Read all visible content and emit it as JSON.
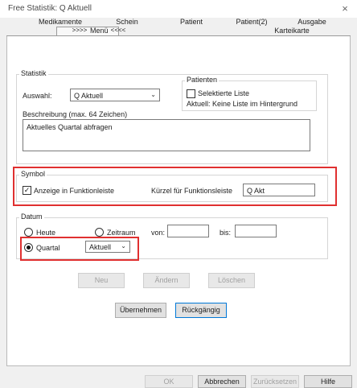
{
  "window": {
    "title": "Free Statistik: Q Aktuell",
    "close_glyph": "×"
  },
  "tabs_top": [
    "Medikamente",
    "Schein",
    "Patient",
    "Patient(2)",
    "Ausgabe"
  ],
  "tabs_bottom": {
    "left": ">>>>",
    "active": "Menü",
    "right": "<<<<",
    "far": "Karteikarte"
  },
  "statistik": {
    "legend": "Statistik",
    "auswahl_label": "Auswahl:",
    "auswahl_value": "Q Aktuell",
    "beschreibung_label": "Beschreibung (max. 64 Zeichen)",
    "beschreibung_value": "Aktuelles Quartal abfragen",
    "patienten": {
      "legend": "Patienten",
      "selektierte_label": "Selektierte Liste",
      "aktuell_text": "Aktuell: Keine Liste im Hintergrund"
    }
  },
  "symbol": {
    "legend": "Symbol",
    "anzeige_label": "Anzeige in Funktionleiste",
    "kuerzel_label": "Kürzel für Funktionsleiste",
    "kuerzel_value": "Q Akt"
  },
  "datum": {
    "legend": "Datum",
    "heute_label": "Heute",
    "zeitraum_label": "Zeitraum",
    "von_label": "von:",
    "bis_label": "bis:",
    "quartal_label": "Quartal",
    "quartal_value": "Aktuell"
  },
  "actions": {
    "neu": "Neu",
    "aendern": "Ändern",
    "loeschen": "Löschen",
    "uebernehmen": "Übernehmen",
    "rueckgaengig": "Rückgängig"
  },
  "footer": {
    "ok": "OK",
    "abbrechen": "Abbrechen",
    "zuruecksetzen": "Zurücksetzen",
    "hilfe": "Hilfe"
  },
  "colors": {
    "highlight_box": "#e03030",
    "focus": "#0078d7"
  }
}
